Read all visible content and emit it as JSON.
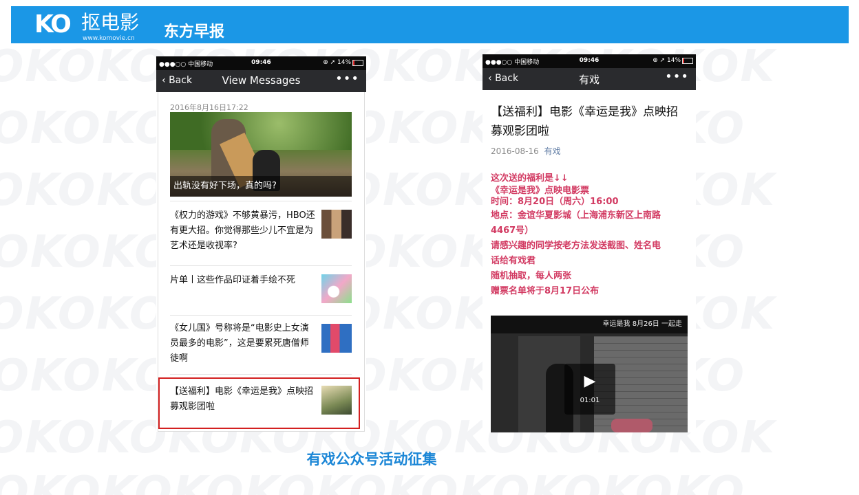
{
  "header": {
    "logo_mark": "KO",
    "logo_text": "抠电影",
    "logo_url": "www.komovie.cn",
    "title": "东方早报",
    "bar_color": "#1b97e6"
  },
  "left_phone": {
    "status": {
      "carrier": "●●●○○ 中国移动 ⁠",
      "time": "09:46",
      "right": "⊕ ➚ 14%"
    },
    "nav": {
      "back": "Back",
      "title": "View Messages",
      "more": "•••"
    },
    "date": "2016年8月16日17:22",
    "hero_caption": "出轨没有好下场，真的吗?",
    "items": [
      {
        "text": "《权力的游戏》不够黄暴污，HBO还有更大招。你觉得那些少儿不宜是为艺术还是收视率?"
      },
      {
        "text": "片单丨这些作品印证着手绘不死"
      },
      {
        "text": "《女儿国》号称将是“电影史上女演员最多的电影”，这是要累死唐僧师徒啊"
      },
      {
        "text": "【送福利】电影《幸运是我》点映招募观影团啦"
      }
    ]
  },
  "right_phone": {
    "status": {
      "carrier": "●●●○○ 中国移动 ⁠",
      "time": "09:46",
      "right": "⊕ ➚ 14%"
    },
    "nav": {
      "back": "Back",
      "title": "有戏",
      "more": "•••"
    },
    "article_title": "【送福利】电影《幸运是我》点映招募观影团啦",
    "date": "2016-08-16",
    "account": "有戏",
    "body_lines": [
      "这次送的福利是↓↓",
      "《幸运是我》点映电影票",
      "时间：8月20日（周六）16:00",
      "地点：金谊华夏影城（上海浦东新区上南路",
      "4467号）",
      "请感兴趣的同学按老方法发送截图、姓名电",
      "话给有戏君",
      "随机抽取，每人两张",
      "赠票名单将于8月17日公布"
    ],
    "video": {
      "banner": "幸运是我  8月26日  一起走",
      "time": "01:01"
    }
  },
  "footer": "有戏公众号活动征集"
}
